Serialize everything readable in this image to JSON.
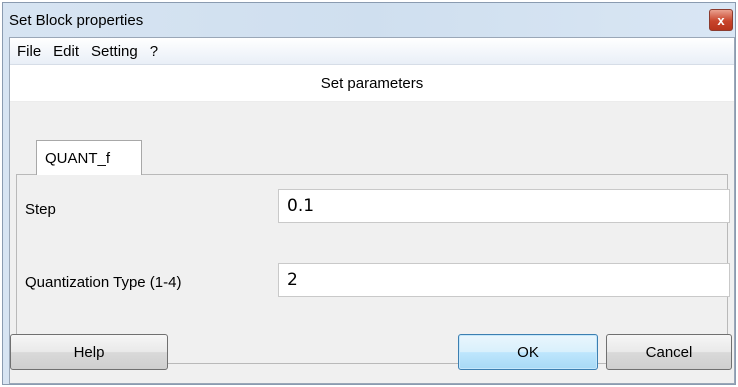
{
  "window": {
    "title": "Set Block properties",
    "close_glyph": "x"
  },
  "menu": [
    "File",
    "Edit",
    "Setting",
    "?"
  ],
  "section_title": "Set parameters",
  "tab": {
    "label": "QUANT_f"
  },
  "params": [
    {
      "label": "Step",
      "value": "0.1"
    },
    {
      "label": "Quantization Type (1-4)",
      "value": "2"
    }
  ],
  "buttons": {
    "help": "Help",
    "ok": "OK",
    "cancel": "Cancel"
  }
}
